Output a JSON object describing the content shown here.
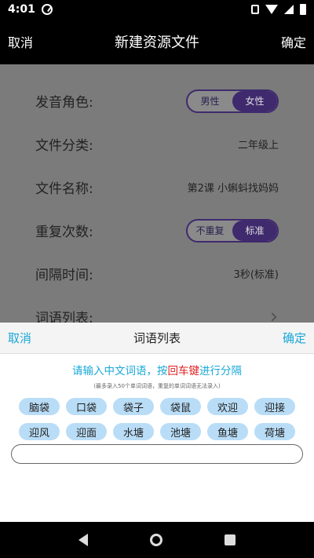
{
  "status": {
    "time": "4:01"
  },
  "header": {
    "cancel": "取消",
    "title": "新建资源文件",
    "confirm": "确定"
  },
  "form": {
    "voice": {
      "label": "发音角色:",
      "options": [
        "男性",
        "女性"
      ],
      "selected": "女性"
    },
    "category": {
      "label": "文件分类:",
      "value": "二年级上"
    },
    "filename": {
      "label": "文件名称:",
      "value": "第2课 小蝌蚪找妈妈"
    },
    "repeat": {
      "label": "重复次数:",
      "options": [
        "不重复",
        "标准"
      ],
      "selected": "标准"
    },
    "interval": {
      "label": "间隔时间:",
      "value": "3秒(标准)"
    },
    "wordlist": {
      "label": "词语列表:"
    }
  },
  "sheet": {
    "cancel": "取消",
    "title": "词语列表",
    "confirm": "确定",
    "hint_prefix": "请输入中文词语，按",
    "hint_key": "回车键",
    "hint_suffix": "进行分隔",
    "subhint": "(最多录入50个单词词语，重复的单词词语无法录入)",
    "words": [
      "脑袋",
      "口袋",
      "袋子",
      "袋鼠",
      "欢迎",
      "迎接",
      "迎风",
      "迎面",
      "水塘",
      "池塘",
      "鱼塘",
      "荷塘"
    ],
    "input_value": ""
  },
  "colors": {
    "accent": "#18a7d8",
    "toggle": "#3f2a6e",
    "chip": "#b9ddf7",
    "key": "#e02020"
  }
}
